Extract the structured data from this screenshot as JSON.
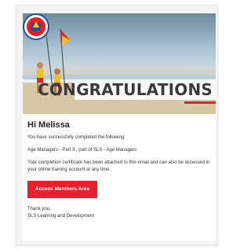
{
  "hero": {
    "banner_text": "CONGRATULATIONS",
    "logo_alt": "SLS",
    "colors": {
      "accent": "#ed1c24",
      "flag_red": "#d8262b",
      "flag_yellow": "#f2c21a"
    }
  },
  "email": {
    "greeting": "Hi Melissa",
    "intro": "You have successfully completed the following:",
    "course": "Age Managers - Part 3 , part of SLS - Age Managers",
    "note": "Your completion certificate has been attached to this email and can also be accessed in your online training account at any time.",
    "button_label": "Access Members Area",
    "signoff": "Thank you,",
    "signature": "SLS Learning and Development"
  }
}
